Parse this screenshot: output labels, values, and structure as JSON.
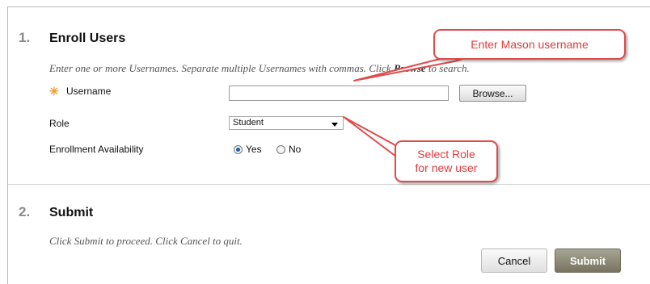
{
  "section1": {
    "number": "1.",
    "title": "Enroll Users",
    "instructions_prefix": "Enter one or more Usernames. Separate multiple Usernames with commas. Click ",
    "instructions_bold": "Browse",
    "instructions_suffix": " to search."
  },
  "form": {
    "username_label": "Username",
    "required_marker": "✳",
    "username_value": "",
    "browse_label": "Browse...",
    "role_label": "Role",
    "role_selected": "Student",
    "availability_label": "Enrollment Availability",
    "availability_yes": "Yes",
    "availability_no": "No",
    "availability_selected": "Yes"
  },
  "section2": {
    "number": "2.",
    "title": "Submit",
    "instructions": "Click Submit to proceed. Click Cancel to quit."
  },
  "buttons": {
    "cancel_label": "Cancel",
    "submit_label": "Submit"
  },
  "annotations": {
    "callout1": "Enter Mason username",
    "callout2_line1": "Select Role",
    "callout2_line2": "for new user"
  },
  "colors": {
    "callout_border": "#e04b4b",
    "callout_text": "#e03c3c",
    "required_star": "#f29a2e",
    "submit_button": "#8f8b78"
  }
}
